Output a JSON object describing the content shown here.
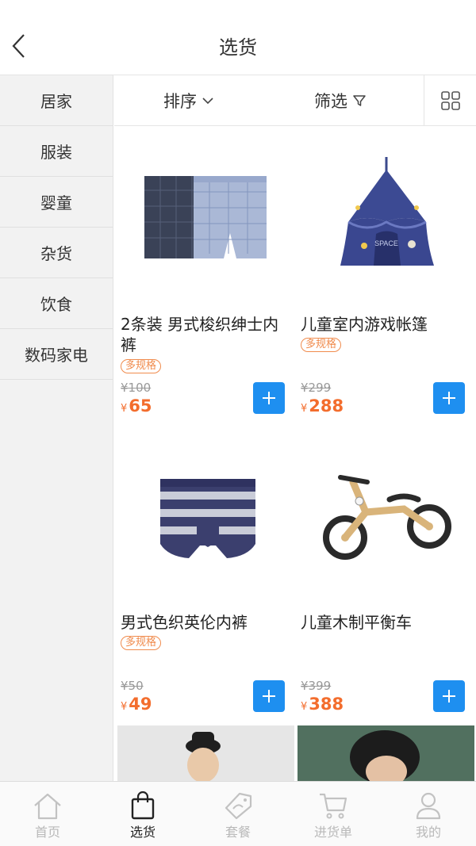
{
  "header": {
    "title": "选货"
  },
  "sidebar": {
    "items": [
      {
        "label": "居家"
      },
      {
        "label": "服装"
      },
      {
        "label": "婴童"
      },
      {
        "label": "杂货"
      },
      {
        "label": "饮食"
      },
      {
        "label": "数码家电"
      }
    ]
  },
  "toolbar": {
    "sort_label": "排序",
    "filter_label": "筛选"
  },
  "products": [
    {
      "name": "2条装 男式梭织绅士内裤",
      "badge": "多规格",
      "old_price": "¥100",
      "currency": "¥",
      "price": "65"
    },
    {
      "name": "儿童室内游戏帐篷",
      "badge": "多规格",
      "old_price": "¥299",
      "currency": "¥",
      "price": "288"
    },
    {
      "name": "男式色织英伦内裤",
      "badge": "多规格",
      "old_price": "¥50",
      "currency": "¥",
      "price": "49"
    },
    {
      "name": "儿童木制平衡车",
      "badge": "",
      "old_price": "¥399",
      "currency": "¥",
      "price": "388"
    }
  ],
  "tabbar": {
    "items": [
      {
        "label": "首页",
        "icon": "home-icon"
      },
      {
        "label": "选货",
        "icon": "shopping-bag-icon"
      },
      {
        "label": "套餐",
        "icon": "tag-icon"
      },
      {
        "label": "进货单",
        "icon": "cart-icon"
      },
      {
        "label": "我的",
        "icon": "user-icon"
      }
    ],
    "active": "选货"
  },
  "colors": {
    "accent": "#1e8ff0",
    "price": "#f36d2d",
    "badge": "#f08b4d"
  }
}
